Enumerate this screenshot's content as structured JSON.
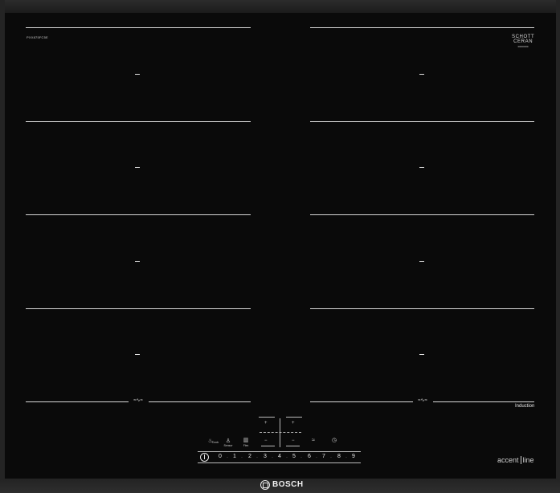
{
  "model": "PXX875FC5E",
  "glass_brand": {
    "line1": "SCHOTT",
    "line2": "CERAN",
    "line3": "0000000"
  },
  "induction_label": "Induction",
  "accent_label": {
    "left": "accent",
    "right": "line"
  },
  "brand": "BOSCH",
  "bridge_symbol_left": "≈∿≈",
  "bridge_symbol_right": "≈∿≈",
  "controls": {
    "plus": "+",
    "minus": "−",
    "cookconnect_icon": "♨",
    "cookconnect_label": "Cook",
    "sensor_icon": "♙",
    "sensor_label": "Sensor",
    "flex_icon": "▥",
    "flex_label": "Flex",
    "pan_icon": "≈",
    "timer_icon": "◷"
  },
  "scale": [
    "0",
    "1",
    "2",
    "3",
    "4",
    "5",
    "6",
    "7",
    "8",
    "9"
  ],
  "scale_dot": "·",
  "colors": {
    "glass": "#0a0a0a",
    "line": "#d8d8d8",
    "text": "#e6e6e6"
  }
}
